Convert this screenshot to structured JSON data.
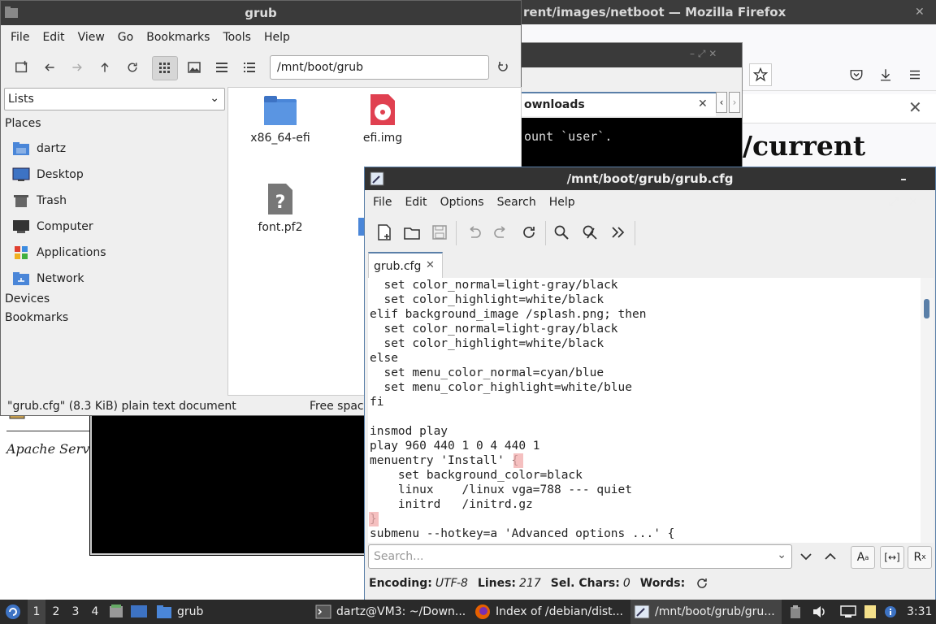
{
  "firefox": {
    "title": "rent/images/netboot — Mozilla Firefox",
    "heading": "/current",
    "apache_text": "Apache Serv",
    "tab_label": "ownloads"
  },
  "terminal": {
    "line": "ount `user`."
  },
  "file_manager": {
    "title": "grub",
    "menu": [
      "File",
      "Edit",
      "View",
      "Go",
      "Bookmarks",
      "Tools",
      "Help"
    ],
    "path": "/mnt/boot/grub",
    "sidebar_mode": "Lists",
    "places_header": "Places",
    "places": [
      "dartz",
      "Desktop",
      "Trash",
      "Computer",
      "Applications",
      "Network"
    ],
    "devices_header": "Devices",
    "bookmarks_header": "Bookmarks",
    "files": [
      "x86_64-efi",
      "efi.img",
      "font.pf2"
    ],
    "status_left": "\"grub.cfg\" (8.3 KiB) plain text document",
    "status_right": "Free space"
  },
  "editor": {
    "title": "/mnt/boot/grub/grub.cfg",
    "menu": [
      "File",
      "Edit",
      "Options",
      "Search",
      "Help"
    ],
    "tab": "grub.cfg",
    "lines": [
      "  set color_normal=light-gray/black",
      "  set color_highlight=white/black",
      "elif background_image /splash.png; then",
      "  set color_normal=light-gray/black",
      "  set color_highlight=white/black",
      "else",
      "  set menu_color_normal=cyan/blue",
      "  set menu_color_highlight=white/blue",
      "fi",
      "",
      "insmod play",
      "play 960 440 1 0 4 440 1",
      "menuentry 'Install' {",
      "    set background_color=black",
      "    linux    /linux vga=788 --- quiet",
      "    initrd   /initrd.gz",
      "}",
      "submenu --hotkey=a 'Advanced options ...' {"
    ],
    "search_placeholder": "Search...",
    "status": {
      "encoding_label": "Encoding:",
      "encoding": "UTF-8",
      "lines_label": "Lines:",
      "lines": "217",
      "sel_label": "Sel. Chars:",
      "sel": "0",
      "words_label": "Words:"
    }
  },
  "taskbar": {
    "workspaces": [
      "1",
      "2",
      "3",
      "4"
    ],
    "grub_btn": "grub",
    "tasks": [
      "dartz@VM3: ~/Down...",
      "Index of /debian/dist...",
      "/mnt/boot/grub/gru..."
    ],
    "clock": "3:31"
  }
}
